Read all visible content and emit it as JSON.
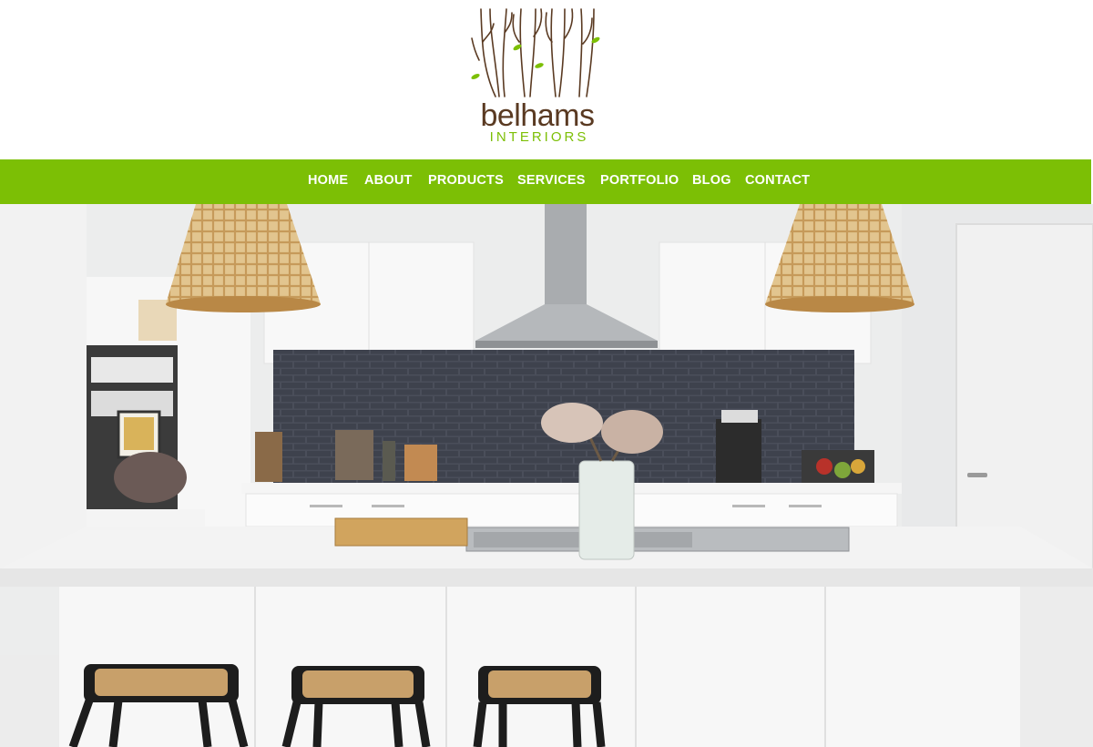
{
  "site": {
    "brand_wordmark": "belhams",
    "brand_subtitle": "INTERIORS",
    "brand_color": "#7cbf05",
    "wordmark_color": "#5a3a22"
  },
  "nav": {
    "items": [
      {
        "label": "HOME"
      },
      {
        "label": "ABOUT"
      },
      {
        "label": "PRODUCTS"
      },
      {
        "label": "SERVICES"
      },
      {
        "label": "PORTFOLIO"
      },
      {
        "label": "BLOG"
      },
      {
        "label": "CONTACT"
      }
    ]
  },
  "hero": {
    "image": "kitchen-photo"
  }
}
